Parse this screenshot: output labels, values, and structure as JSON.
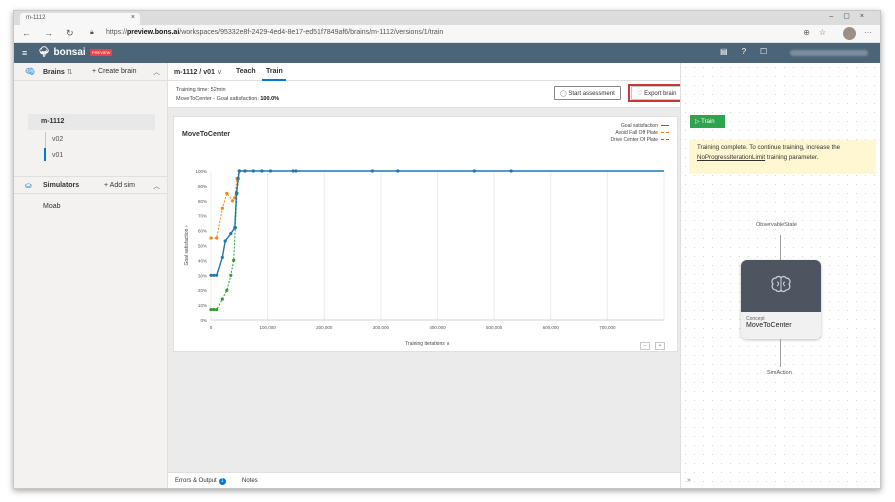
{
  "browser": {
    "tab_title": "m-1112",
    "url_prefix": "https://",
    "url_host": "preview.bons.ai",
    "url_path": "/workspaces/95332e8f-2429-4ed4-8e17-ed51f7849af6/brains/m-1112/versions/1/train"
  },
  "app": {
    "name": "bonsai",
    "badge": "PREVIEW"
  },
  "sidebar": {
    "brains_title": "Brains",
    "brains_sort": "⇅",
    "create_brain": "+ Create brain",
    "brain_name": "m-1112",
    "versions": [
      "v02",
      "v01"
    ],
    "simulators_title": "Simulators",
    "add_sim": "+ Add sim",
    "simulator_name": "Moab"
  },
  "main": {
    "brain_version": "m-1112 / v01",
    "tabs": [
      "Teach",
      "Train"
    ],
    "active_tab": "Train",
    "training_time_label": "Training time: 52min",
    "goal_label": "MoveToCenter - Goal satisfaction:",
    "goal_value": "100.0%",
    "start_assessment": "Start assessment",
    "export_brain": "Export brain",
    "errors_output": "Errors & Output",
    "errors_count": "1",
    "notes": "Notes"
  },
  "chart_data": {
    "type": "line",
    "title": "MoveToCenter",
    "xlabel": "Training iterations",
    "ylabel": "Goal satisfaction",
    "xlim": [
      0,
      800000
    ],
    "ylim": [
      0,
      100
    ],
    "x_ticks": [
      "0",
      "100,000",
      "200,000",
      "300,000",
      "400,000",
      "500,000",
      "600,000",
      "700,000"
    ],
    "y_ticks": [
      "0%",
      "10%",
      "20%",
      "30%",
      "40%",
      "50%",
      "60%",
      "70%",
      "80%",
      "90%",
      "100%"
    ],
    "legend_position": "top-right",
    "series": [
      {
        "name": "Goal satisfaction",
        "color": "#1f77b4",
        "style": "solid",
        "markers": true,
        "points": [
          [
            0,
            30
          ],
          [
            5000,
            30
          ],
          [
            10000,
            30
          ],
          [
            20000,
            42
          ],
          [
            25000,
            53
          ],
          [
            35000,
            58
          ],
          [
            42000,
            62
          ],
          [
            45000,
            85
          ],
          [
            48000,
            95
          ],
          [
            50000,
            100
          ],
          [
            60000,
            100
          ],
          [
            75000,
            100
          ],
          [
            90000,
            100
          ],
          [
            105000,
            100
          ],
          [
            145000,
            100
          ],
          [
            150000,
            100
          ],
          [
            285000,
            100
          ],
          [
            330000,
            100
          ],
          [
            465000,
            100
          ],
          [
            530000,
            100
          ],
          [
            800000,
            100
          ]
        ]
      },
      {
        "name": "Avoid Fall Off Plate",
        "color": "#ff7f0e",
        "style": "dashed",
        "markers": true,
        "points": [
          [
            0,
            55
          ],
          [
            10000,
            55
          ],
          [
            20000,
            75
          ],
          [
            28000,
            85
          ],
          [
            38000,
            80
          ],
          [
            42000,
            82
          ],
          [
            46000,
            95
          ],
          [
            50000,
            100
          ],
          [
            60000,
            100
          ],
          [
            75000,
            100
          ]
        ]
      },
      {
        "name": "Drive Center Of Plate",
        "color": "#2ca02c",
        "style": "dashed",
        "markers": true,
        "points": [
          [
            0,
            7
          ],
          [
            5000,
            7
          ],
          [
            10000,
            7
          ],
          [
            20000,
            14
          ],
          [
            28000,
            20
          ],
          [
            35000,
            30
          ],
          [
            40000,
            40
          ],
          [
            43000,
            62
          ],
          [
            46000,
            85
          ],
          [
            50000,
            100
          ],
          [
            60000,
            100
          ]
        ]
      }
    ]
  },
  "right_panel": {
    "train_button": "▷ Train",
    "notice_before": "Training complete. To continue training, increase the",
    "notice_link": "NoProgressIterationLimit",
    "notice_after": "training parameter.",
    "graph_input": "ObservableState",
    "concept_kind": "Concept",
    "concept_name": "MoveToCenter",
    "graph_output": "SimAction"
  },
  "colors": {
    "header_bg": "#4b6478",
    "accent": "#0078d4",
    "train_green": "#2da44e",
    "highlight_red": "#d13438"
  }
}
